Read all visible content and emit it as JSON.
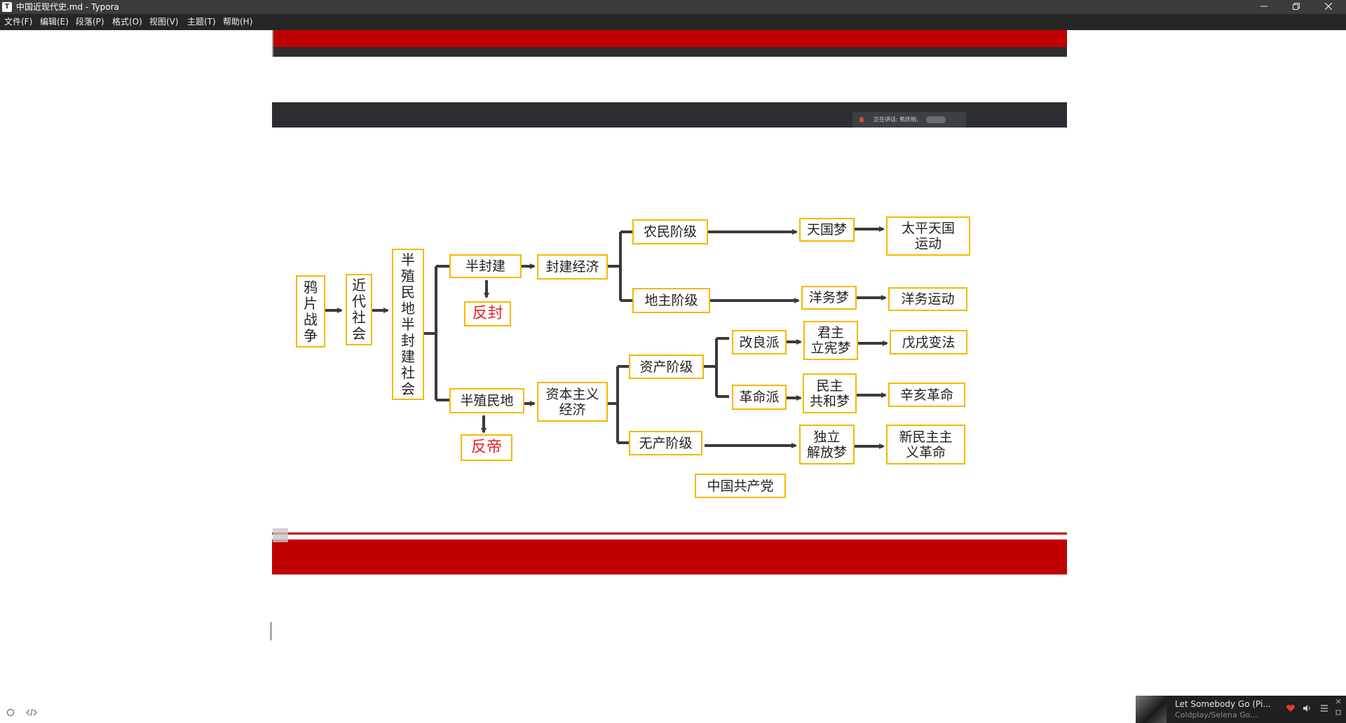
{
  "window": {
    "title": "中国近现代史.md - Typora",
    "app_icon": "T",
    "minimize_icon": "minimize-icon",
    "restore_icon": "restore-icon",
    "close_icon": "close-icon"
  },
  "menu": [
    {
      "label": "文件(F)"
    },
    {
      "label": "编辑(E)"
    },
    {
      "label": "段落(P)"
    },
    {
      "label": "格式(O)"
    },
    {
      "label": "视图(V)"
    },
    {
      "label": "主题(T)"
    },
    {
      "label": "帮助(H)"
    }
  ],
  "slide": {
    "speaker_tag": "正在讲话: 熊庆桃;",
    "diagram": {
      "nodes": {
        "opium_war": "鸦\n片\n战\n争",
        "modern_society": "近\n代\n社\n会",
        "semi_colonial_semi_feudal": "半\n殖\n民\n地\n半\n封\n建\n社\n会",
        "semi_feudal": "半封建",
        "anti_feudal": "反封",
        "feudal_economy": "封建经济",
        "peasant_class": "农民阶级",
        "heavenly_kingdom_dream": "天国梦",
        "taiping_movement": "太平天国\n运动",
        "landlord_class": "地主阶级",
        "westernization_dream": "洋务梦",
        "westernization_movement": "洋务运动",
        "semi_colonial": "半殖民地",
        "anti_imperialist": "反帝",
        "capitalist_economy": "资本主义\n经济",
        "bourgeoisie": "资产阶级",
        "reformists": "改良派",
        "constitutional_monarchy_dream": "君主\n立宪梦",
        "hundred_days_reform": "戊戌变法",
        "revolutionaries": "革命派",
        "republic_dream": "民主\n共和梦",
        "xinhai_revolution": "辛亥革命",
        "proletariat": "无产阶级",
        "independence_dream": "独立\n解放梦",
        "new_democratic_revolution": "新民主主\n义革命",
        "ccp": "中国共产党"
      }
    }
  },
  "footer": {
    "outline_icon": "circle-icon",
    "source_icon": "code-icon"
  },
  "player": {
    "song": "Let Somebody Go (Pi...",
    "artist": "Coldplay/Selena Go...",
    "icons": [
      "heart-icon",
      "volume-icon",
      "playlist-icon"
    ]
  },
  "colors": {
    "accent_red": "#c00000",
    "node_border": "#f5b800",
    "red_text": "#e2232a",
    "dark_band": "#2c2e31"
  }
}
